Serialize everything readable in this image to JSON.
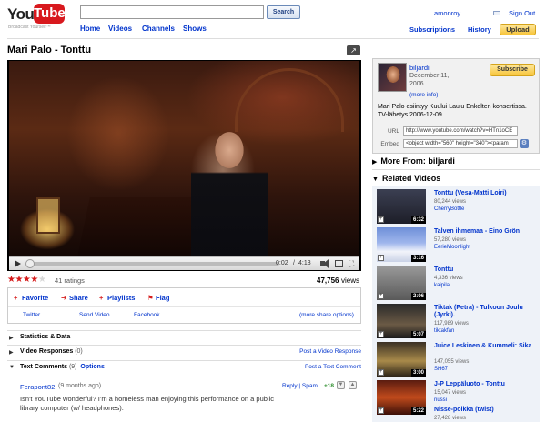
{
  "header": {
    "logo_you": "You",
    "logo_tube": "Tube",
    "tagline": "Broadcast Yourself™",
    "search_button": "Search",
    "search_value": "",
    "nav": [
      "Home",
      "Videos",
      "Channels",
      "Shows"
    ],
    "username": "amonroy",
    "sign_out": "Sign Out",
    "subscriptions": "Subscriptions",
    "history": "History",
    "upload": "Upload"
  },
  "video": {
    "title": "Mari Palo - Tonttu",
    "current_time": "0:02",
    "time_separator": "/",
    "total_time": "4:13",
    "progress_fraction": 0.01,
    "rating": 4.5,
    "ratings_text": "41 ratings",
    "views_number": "47,756",
    "views_label": "views"
  },
  "actions": {
    "favorite": "Favorite",
    "share": "Share",
    "playlists": "Playlists",
    "flag": "Flag",
    "twitter": "Twitter",
    "send_video": "Send Video",
    "facebook": "Facebook",
    "more_share": "(more share options)"
  },
  "sections": {
    "stats": "Statistics & Data",
    "responses": "Video Responses",
    "responses_count": "(0)",
    "post_response": "Post a Video Response",
    "comments": "Text Comments",
    "comments_count": "(9)",
    "options": "Options",
    "post_comment": "Post a Text Comment"
  },
  "comment": {
    "author": "Ferapont82",
    "meta": "(9 months ago)",
    "actions": "Reply | Spam",
    "score": "+18",
    "text": "Isn't YouTube wonderful? I'm a homeless man enjoying this performance on a public library computer (w/ headphones)."
  },
  "channel": {
    "name": "biljardi",
    "date": "December 11, 2006",
    "more_info": "(more info)",
    "subscribe": "Subscribe",
    "description": "Mari Palo esiintyy Kuului Laulu Enkelten konsertissa. TV-lähetys 2006-12-09.",
    "url_label": "URL",
    "url_value": "http://www.youtube.com/watch?v=HTn1oCE",
    "embed_label": "Embed",
    "embed_value": "<object width=\"560\" height=\"340\"><param"
  },
  "more_from": "More From: biljardi",
  "related_heading": "Related Videos",
  "related": [
    {
      "title": "Tonttu (Vesa-Matti Loiri)",
      "views": "80,244 views",
      "user": "CherryBottle",
      "duration": "6:32"
    },
    {
      "title": "Talven ihmemaa - Eino Grön",
      "views": "57,280 views",
      "user": "EerieMoonlight",
      "duration": "3:16"
    },
    {
      "title": "Tonttu",
      "views": "4,336 views",
      "user": "kaipila",
      "duration": "2:06"
    },
    {
      "title": "Tiktak (Petra) - Tulkoon Joulu (Jyrki).",
      "views": "117,989 views",
      "user": "tiktakfan",
      "duration": "5:07"
    },
    {
      "title": "Juice Leskinen & Kummeli: Sika",
      "views": "147,055 views",
      "user": "SH67",
      "duration": "3:00"
    },
    {
      "title": "J-P Leppäluoto - Tonttu",
      "views": "15,047 views",
      "user": "riussi",
      "duration": "5:22"
    },
    {
      "title": "Nisse-polkka (twist)",
      "views": "27,428 views",
      "user": "",
      "duration": ""
    }
  ],
  "colors": {
    "brand_red": "#d8191e",
    "link_blue": "#0033cc",
    "star_red": "#d61c1c",
    "upload_yellow": "#f7c43a"
  }
}
